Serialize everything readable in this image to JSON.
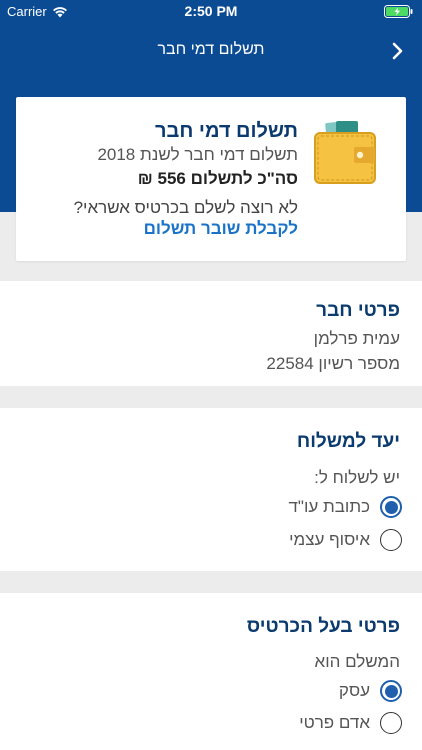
{
  "status": {
    "carrier": "Carrier",
    "time": "2:50 PM"
  },
  "nav": {
    "title": "תשלום דמי חבר"
  },
  "payment_card": {
    "title": "תשלום דמי חבר",
    "subtitle": "תשלום דמי חבר לשנת 2018",
    "total": "סה\"כ לתשלום 556 ₪",
    "question": "לא רוצה לשלם בכרטיס אשראי?",
    "link": "לקבלת שובר תשלום"
  },
  "member": {
    "title": "פרטי חבר",
    "name": "עמית פרלמן",
    "license": "מספר רשיון 22584"
  },
  "shipping": {
    "title": "יעד למשלוח",
    "prompt": "יש לשלוח ל:",
    "options": [
      {
        "label": "כתובת עו\"ד",
        "checked": true
      },
      {
        "label": "איסוף עצמי",
        "checked": false
      }
    ]
  },
  "cardholder": {
    "title": "פרטי בעל הכרטיס",
    "prompt": "המשלם הוא",
    "options": [
      {
        "label": "עסק",
        "checked": true
      },
      {
        "label": "אדם פרטי",
        "checked": false
      }
    ]
  },
  "colors": {
    "primary": "#0b4b93",
    "link": "#1a73c8",
    "radio": "#1f5fad"
  }
}
